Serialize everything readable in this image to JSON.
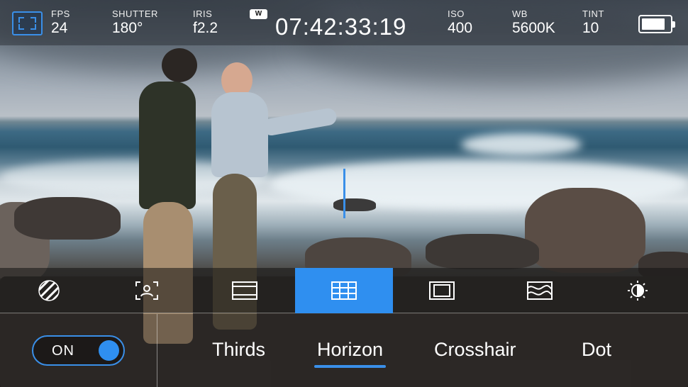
{
  "status": {
    "fps_label": "FPS",
    "fps_value": "24",
    "shutter_label": "SHUTTER",
    "shutter_value": "180°",
    "iris_label": "IRIS",
    "iris_value": "f2.2",
    "w_badge": "W",
    "timecode": "07:42:33:19",
    "iso_label": "ISO",
    "iso_value": "400",
    "wb_label": "WB",
    "wb_value": "5600K",
    "tint_label": "TINT",
    "tint_value": "10",
    "battery_level": 0.85
  },
  "tools": [
    {
      "icon": "zebra-icon"
    },
    {
      "icon": "focus-assist-icon"
    },
    {
      "icon": "frame-guides-icon"
    },
    {
      "icon": "grid-icon",
      "active": true
    },
    {
      "icon": "safe-area-icon"
    },
    {
      "icon": "false-color-icon"
    },
    {
      "icon": "brightness-icon"
    }
  ],
  "grid_options": {
    "toggle_label": "ON",
    "options": [
      "Thirds",
      "Horizon",
      "Crosshair",
      "Dot"
    ],
    "selected": "Horizon"
  },
  "colors": {
    "accent": "#2f8ff0",
    "text": "#ffffff"
  }
}
